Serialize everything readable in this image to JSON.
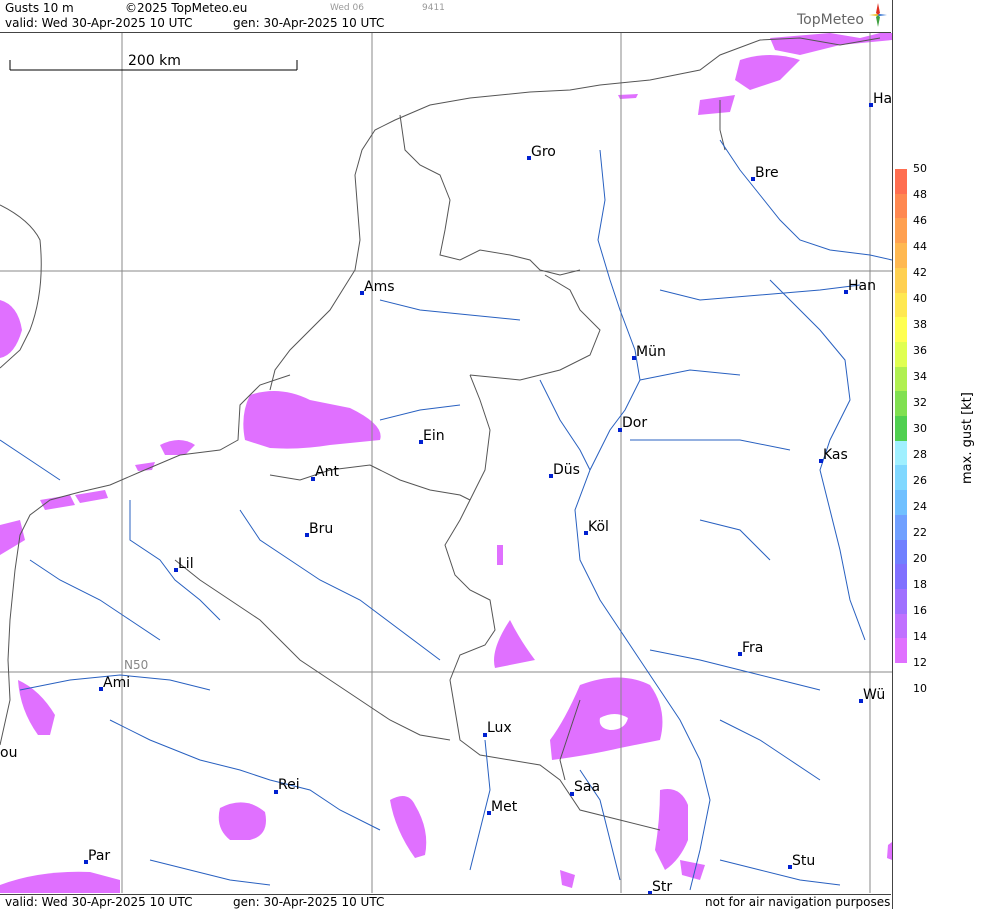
{
  "header": {
    "param": "Gusts 10 m",
    "copyright": "©2025 TopMeteo.eu",
    "small1": "Wed 06",
    "small2": "9411",
    "valid": "valid:  Wed  30-Apr-2025  10 UTC",
    "gen": "gen: 30-Apr-2025 10 UTC",
    "logo": "TopMeteo"
  },
  "footer": {
    "valid": "valid:  Wed  30-Apr-2025  10 UTC",
    "gen": "gen: 30-Apr-2025 10 UTC",
    "note": "not for air navigation purposes"
  },
  "scale_label": "200 km",
  "grid_label": "N50",
  "cities": [
    "Gro",
    "Bre",
    "Ha",
    "Ams",
    "Han",
    "Mün",
    "Dor",
    "Ein",
    "Kas",
    "Düs",
    "Ant",
    "Köl",
    "Bru",
    "Lil",
    "Fra",
    "Ami",
    "Wü",
    "Lux",
    "ou",
    "Rei",
    "Saa",
    "Met",
    "Par",
    "Stu",
    "Str"
  ],
  "legend": {
    "title": "max. gust [kt]",
    "ticks": [
      "50",
      "48",
      "46",
      "44",
      "42",
      "40",
      "38",
      "36",
      "34",
      "32",
      "30",
      "28",
      "26",
      "24",
      "22",
      "20",
      "18",
      "16",
      "14",
      "12",
      "10"
    ],
    "colors": [
      "#ff6e50",
      "#ff8850",
      "#ffa050",
      "#ffb850",
      "#ffd050",
      "#ffe850",
      "#ffff50",
      "#e0ff50",
      "#b0f050",
      "#80e050",
      "#50d050",
      "#a0f0ff",
      "#80d8ff",
      "#70c0ff",
      "#70a0ff",
      "#7080ff",
      "#8070ff",
      "#a070ff",
      "#c070ff",
      "#e070ff"
    ]
  }
}
